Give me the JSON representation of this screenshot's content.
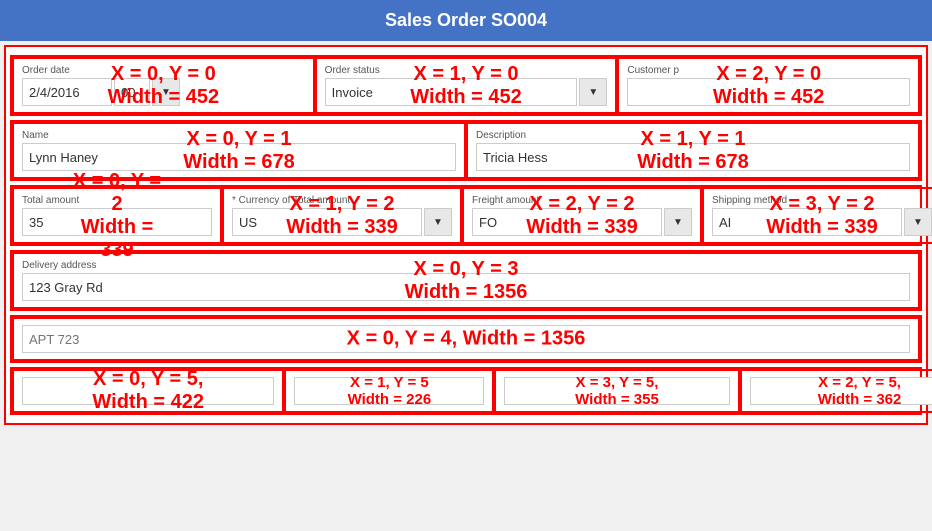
{
  "title": "Sales Order SO004",
  "rows": [
    {
      "id": "row0",
      "cells": [
        {
          "label": "Order date",
          "overlay_line1": "X = 0, Y = 0",
          "overlay_line2": "Width = 452",
          "input_value": "2/4/2016",
          "extra_input": "00",
          "has_dropdown": true,
          "required": false
        },
        {
          "label": "Order status",
          "overlay_line1": "X = 1, Y = 0",
          "overlay_line2": "Width = 452",
          "input_value": "Invoice",
          "has_dropdown": true,
          "required": false
        },
        {
          "label": "Customer p",
          "overlay_line1": "X = 2, Y = 0",
          "overlay_line2": "Width = 452",
          "input_value": "",
          "has_dropdown": false,
          "required": false
        }
      ]
    },
    {
      "id": "row1",
      "cells": [
        {
          "label": "Name",
          "overlay_line1": "X = 0, Y = 1",
          "overlay_line2": "Width = 678",
          "input_value": "Lynn Haney",
          "has_dropdown": false,
          "required": false
        },
        {
          "label": "Description",
          "overlay_line1": "X = 1, Y = 1",
          "overlay_line2": "Width = 678",
          "input_value": "Tricia Hess",
          "has_dropdown": false,
          "required": false
        }
      ]
    },
    {
      "id": "row2",
      "cells": [
        {
          "label": "Total amount",
          "overlay_line1": "X = 0, Y = 2",
          "overlay_line2": "Width = 339",
          "input_value": "35",
          "has_dropdown": false,
          "required": false
        },
        {
          "label": "* Currency of Total amount",
          "overlay_line1": "X = 1, Y = 2",
          "overlay_line2": "Width = 339",
          "input_value": "US",
          "has_dropdown": true,
          "required": true
        },
        {
          "label": "Freight amount",
          "overlay_line1": "X = 2, Y = 2",
          "overlay_line2": "Width = 339",
          "input_value": "FO",
          "has_dropdown": true,
          "required": false
        },
        {
          "label": "Shipping method",
          "overlay_line1": "X = 3, Y = 2",
          "overlay_line2": "Width = 339",
          "input_value": "AI",
          "has_dropdown": true,
          "required": false
        }
      ]
    },
    {
      "id": "row3",
      "cells": [
        {
          "label": "Delivery address",
          "overlay_line1": "X = 0, Y = 3",
          "overlay_line2": "Width = 1356",
          "input_value": "123 Gray Rd",
          "has_dropdown": false,
          "required": false
        }
      ]
    },
    {
      "id": "row4",
      "cells": [
        {
          "label": "",
          "overlay_line1": "X = 0, Y = 4, Width = 1356",
          "overlay_line2": "",
          "input_value": "APT 723",
          "has_dropdown": false,
          "required": false
        }
      ]
    },
    {
      "id": "row5",
      "cells": [
        {
          "label": "",
          "overlay_line1": "X = 0, Y = 5, Width = 422",
          "overlay_line2": "",
          "input_value": "",
          "has_dropdown": false,
          "width_class": "cell-r0",
          "required": false
        },
        {
          "label": "",
          "overlay_line1": "X = 1, Y = 5",
          "overlay_line2": "Width = 226",
          "input_value": "",
          "has_dropdown": false,
          "width_class": "cell-r1",
          "required": false
        },
        {
          "label": "",
          "overlay_line1": "X = 3, Y = 5, Width = 355",
          "overlay_line2": "",
          "input_value": "",
          "has_dropdown": false,
          "width_class": "cell-r2",
          "required": false
        },
        {
          "label": "",
          "overlay_line1": "X = 2, Y = 5, Width = 362",
          "overlay_line2": "",
          "input_value": "",
          "has_dropdown": true,
          "width_class": "cell-r3",
          "required": false
        }
      ]
    }
  ]
}
